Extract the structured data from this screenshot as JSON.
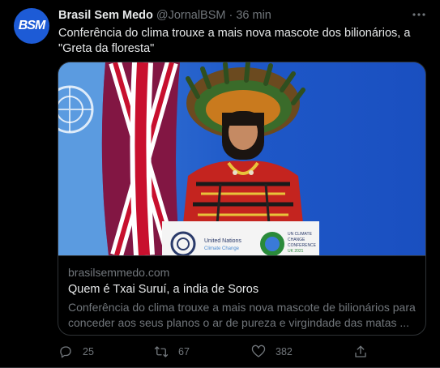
{
  "tweet": {
    "avatar_text": "BSM",
    "name": "Brasil Sem Medo",
    "handle": "@JornalBSM",
    "separator": "·",
    "time": "36 min",
    "more_icon": "more-horizontal-icon",
    "text": "Conferência do clima trouxe a mais nova mascote dos bilionários, a \"Greta da floresta\""
  },
  "card": {
    "podium": {
      "org": "United Nations",
      "org_sub": "Climate Change",
      "event_line1": "UN CLIMATE",
      "event_line2": "CHANGE",
      "event_line3": "CONFERENCE",
      "event_line4": "UK 2021"
    },
    "domain": "brasilsemmedo.com",
    "title": "Quem é Txai Suruí, a índia de Soros",
    "description": "Conferência do clima trouxe a mais nova mascote de bilionários para conceder aos seus planos o ar de pureza e virgindade das matas ..."
  },
  "actions": {
    "reply_count": "25",
    "retweet_count": "67",
    "like_count": "382",
    "icons": [
      "reply-icon",
      "retweet-icon",
      "like-icon",
      "share-icon"
    ]
  },
  "colors": {
    "background": "#000000",
    "text": "#e7e9ea",
    "muted": "#71767b",
    "border": "#2f3336",
    "avatar": "#1d5bd6"
  }
}
